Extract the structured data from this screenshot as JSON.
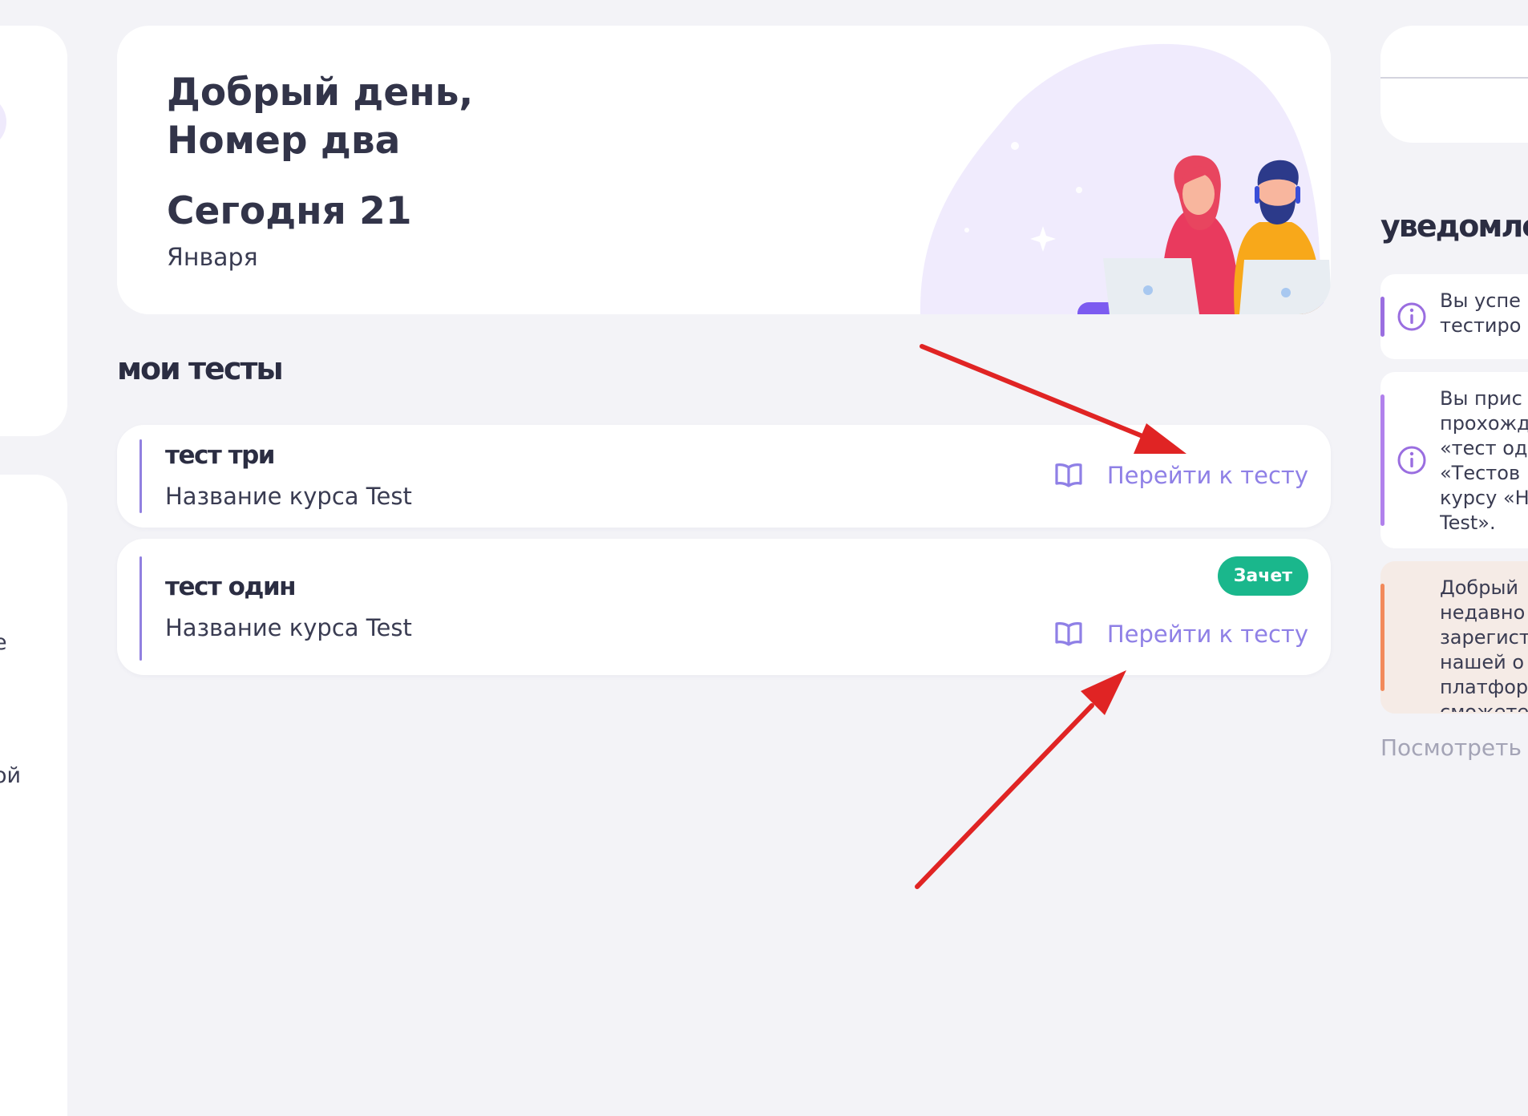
{
  "sidebar": {
    "fragments": [
      "е",
      "ой"
    ]
  },
  "hero": {
    "greeting_line1": "Добрый день,",
    "greeting_line2": "Номер два",
    "date_line": "Сегодня 21",
    "month": "Января"
  },
  "tests": {
    "title": "мои тесты",
    "items": [
      {
        "name": "тест три",
        "course": "Название курса Test",
        "link_label": "Перейти к тесту",
        "link_icon": "book-open-icon",
        "badge": ""
      },
      {
        "name": "тест один",
        "course": "Название курса Test",
        "link_label": "Перейти к тесту",
        "link_icon": "book-open-icon",
        "badge": "Зачет"
      }
    ]
  },
  "notifications": {
    "title": "уведомления",
    "items": [
      {
        "text": "Вы успе\nтестиро",
        "icon": "info-icon"
      },
      {
        "text": "Вы прис\nпрохожд\n«тест од\n«Тестов\nкурсу «Н\nTest».",
        "icon": "info-icon"
      },
      {
        "text": "Добрый\nнедавно\nзарегист\nнашей о\nплатфор\nсможете",
        "icon": ""
      }
    ],
    "more_label": "Посмотреть"
  },
  "colors": {
    "accent": "#8f80e6",
    "badge_green": "#1ab78c",
    "info_purple": "#9a6ee0",
    "notice_orange": "#f28a5b",
    "annotation_red": "#e02424"
  }
}
